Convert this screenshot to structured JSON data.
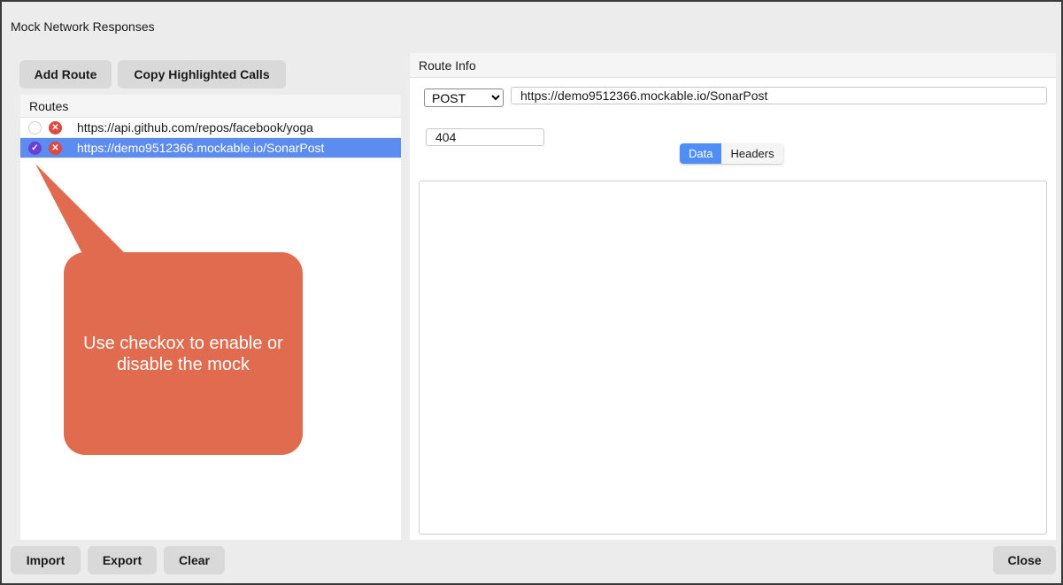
{
  "window": {
    "title": "Mock Network Responses"
  },
  "toolbar": {
    "add_route": "Add Route",
    "copy_highlighted": "Copy Highlighted Calls"
  },
  "routes": {
    "header": "Routes",
    "items": [
      {
        "url": "https://api.github.com/repos/facebook/yoga",
        "enabled": false,
        "selected": false
      },
      {
        "url": "https://demo9512366.mockable.io/SonarPost",
        "enabled": true,
        "selected": true
      }
    ]
  },
  "route_info": {
    "header": "Route Info",
    "method": "POST",
    "method_options": [
      "POST"
    ],
    "url": "https://demo9512366.mockable.io/SonarPost",
    "status": "404",
    "tabs": [
      {
        "label": "Data",
        "active": true
      },
      {
        "label": "Headers",
        "active": false
      }
    ],
    "data_content": ""
  },
  "callout": {
    "text": "Use checkox to enable or disable the mock",
    "color": "#e06b4e"
  },
  "footer": {
    "import": "Import",
    "export": "Export",
    "clear": "Clear",
    "close": "Close"
  },
  "colors": {
    "selected_row": "#5d8cf0",
    "active_tab": "#4f8ef5",
    "checkbox_on": "#6a3fd6",
    "delete_icon": "#e0473e"
  }
}
